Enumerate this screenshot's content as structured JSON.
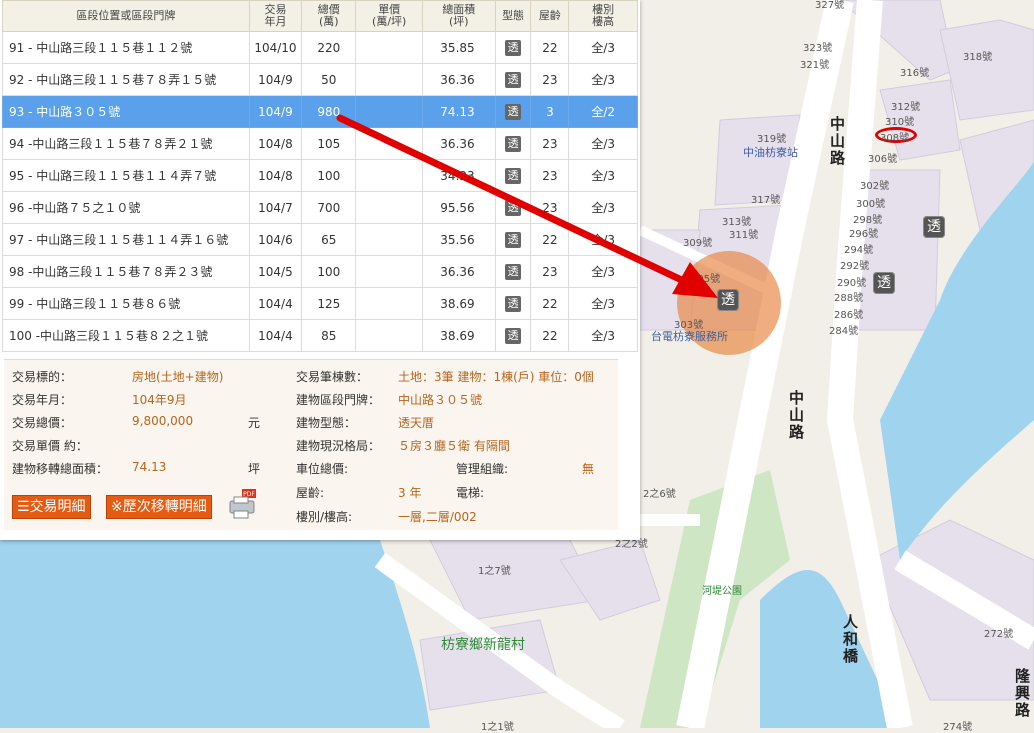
{
  "table": {
    "headers": [
      "區段位置或區段門牌",
      "交易\n年月",
      "總價\n(萬)",
      "單價\n(萬/坪)",
      "總面積\n(坪)",
      "型態",
      "屋齡",
      "樓別\n樓高"
    ],
    "rows": [
      {
        "addr": "91 - 中山路三段１１５巷１１２號",
        "date": "104/10",
        "price": "220",
        "unit": "",
        "area": "35.85",
        "type": "透",
        "age": "22",
        "floor": "全/3"
      },
      {
        "addr": "92 - 中山路三段１１５巷７８弄１５號",
        "date": "104/9",
        "price": "50",
        "unit": "",
        "area": "36.36",
        "type": "透",
        "age": "23",
        "floor": "全/3"
      },
      {
        "addr": "93 - 中山路３０５號",
        "date": "104/9",
        "price": "980",
        "unit": "",
        "area": "74.13",
        "type": "透",
        "age": "3",
        "floor": "全/2"
      },
      {
        "addr": "94 -中山路三段１１５巷７８弄２１號",
        "date": "104/8",
        "price": "105",
        "unit": "",
        "area": "36.36",
        "type": "透",
        "age": "23",
        "floor": "全/3"
      },
      {
        "addr": "95 - 中山路三段１１５巷１１４弄７號",
        "date": "104/8",
        "price": "100",
        "unit": "",
        "area": "34.23",
        "type": "透",
        "age": "23",
        "floor": "全/3"
      },
      {
        "addr": "96 -中山路７５之１０號",
        "date": "104/7",
        "price": "700",
        "unit": "",
        "area": "95.56",
        "type": "透",
        "age": "23",
        "floor": "全/3"
      },
      {
        "addr": "97 - 中山路三段１１５巷１１４弄１６號",
        "date": "104/6",
        "price": "65",
        "unit": "",
        "area": "35.56",
        "type": "透",
        "age": "22",
        "floor": "全/3"
      },
      {
        "addr": "98 -中山路三段１１５巷７８弄２３號",
        "date": "104/5",
        "price": "100",
        "unit": "",
        "area": "36.36",
        "type": "透",
        "age": "23",
        "floor": "全/3"
      },
      {
        "addr": "99 - 中山路三段１１５巷８６號",
        "date": "104/4",
        "price": "125",
        "unit": "",
        "area": "38.69",
        "type": "透",
        "age": "22",
        "floor": "全/3"
      },
      {
        "addr": "100 -中山路三段１１５巷８２之１號",
        "date": "104/4",
        "price": "85",
        "unit": "",
        "area": "38.69",
        "type": "透",
        "age": "22",
        "floor": "全/3"
      }
    ]
  },
  "detail": {
    "l1": "交易標的：",
    "v1": "房地(土地+建物)",
    "l2": "交易年月：",
    "v2": "104年9月",
    "l3": "交易總價：",
    "v3": "9,800,000",
    "u3": "元",
    "l4": "交易單價 約：",
    "l5": "建物移轉總面積：",
    "v5": "74.13",
    "u5": "坪",
    "r1": "交易筆棟數：",
    "rv1": "土地：3筆 建物：1棟(戶) 車位：0個",
    "r2": "建物區段門牌：",
    "rv2": "中山路３０５號",
    "r3": "建物型態：",
    "rv3": "透天厝",
    "r4": "建物現況格局：",
    "rv4": "５房３廳５衛 有隔間",
    "r5": "車位總價:",
    "r5b": "管理組織:",
    "rv5b": "無",
    "r6": "屋齡:",
    "rv6": "3 年",
    "r6b": "電梯:",
    "r7": "樓別/樓高:",
    "rv7": "一層,二層/002"
  },
  "buttons": {
    "detail": "交易明細",
    "history": "※歷次移轉明細"
  },
  "map": {
    "labels": {
      "a327": "327號",
      "a323": "323號",
      "a321": "321號",
      "a318": "318號",
      "a316": "316號",
      "a312": "312號",
      "a310": "310號",
      "a308": "308號",
      "a306": "306號",
      "a319": "319號",
      "a317": "317號",
      "a313": "313號",
      "a311": "311號",
      "a309": "309號",
      "a305": "305號",
      "a303": "303號",
      "a302": "302號",
      "a300": "300號",
      "a298": "298號",
      "a296": "296號",
      "a294": "294號",
      "a292": "292號",
      "a290": "290號",
      "a288": "288號",
      "a286": "286號",
      "a284": "284號",
      "a2z6": "2之6號",
      "a2z2": "2之2號",
      "a1z7": "1之7號",
      "a272": "272號",
      "a274": "274號",
      "a1z1": "1之1號",
      "station": "中油枋寮站",
      "office": "台電枋寮服務所",
      "park": "河堤公園",
      "village": "枋寮鄉新龍村",
      "road1": "中山路",
      "road2": "中山路",
      "bridge": "人和橋",
      "road3": "隆興路"
    },
    "tou": "透"
  },
  "colors": {
    "selected": "#5aa0ea",
    "accent": "#b5651d",
    "button": "#e55b12",
    "water": "#9fd3ee",
    "arrow": "#e00000"
  }
}
